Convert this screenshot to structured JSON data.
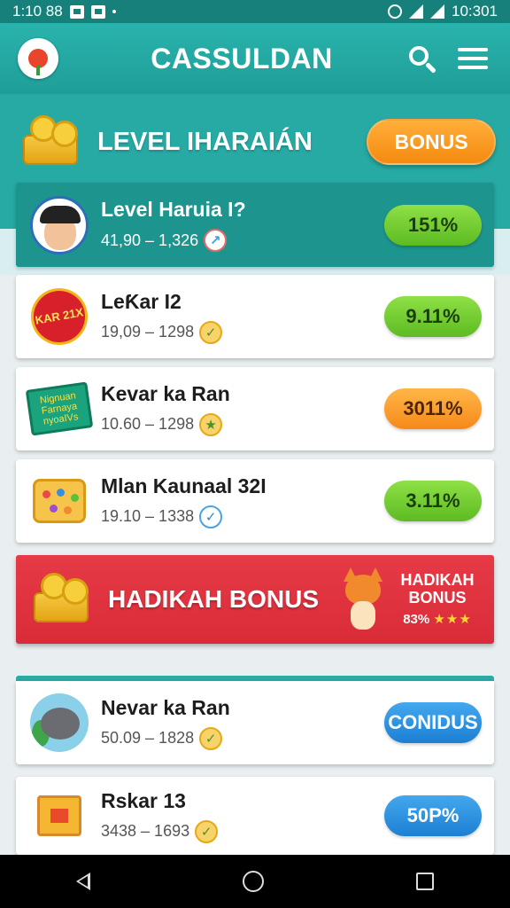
{
  "status_bar": {
    "time_left": "1:10 88",
    "time_right": "10:301"
  },
  "app_bar": {
    "title": "CASSULDAN"
  },
  "banner": {
    "title": "LEVEL IHARAIÁN",
    "bonus_label": "BONUS"
  },
  "featured": {
    "name": "Level Haruia I?",
    "range": "41,90 – 1,326",
    "badge": "↗",
    "percent": "151%"
  },
  "items": [
    {
      "name": "LeƘar I2",
      "range": "19,09 – 1298",
      "badge": "✓",
      "percent": "9.11%",
      "thumb_text": "KAR 21X",
      "pill_color": "green"
    },
    {
      "name": "Kevar ka Ran",
      "range": "10.60 – 1298",
      "badge": "★",
      "percent": "3011%",
      "thumb_text": "Nignuan Farnaya nyoaIVs",
      "pill_color": "orange"
    },
    {
      "name": "Mlan Kaunaal 32I",
      "range": "19.10 – 1338",
      "badge": "✓",
      "percent": "3.11%",
      "pill_color": "green"
    }
  ],
  "promo": {
    "title": "HADIKAH BONUS",
    "side_title": "HADIKAH BONUS",
    "rating": "83%",
    "stars": "★★★"
  },
  "items2": [
    {
      "name": "Nevar ka Ran",
      "range": "50.09 – 1828",
      "badge": "✓",
      "button": "CONIDUS",
      "pill_color": "blue"
    },
    {
      "name": "Rskar 13",
      "range": "3438 – 1693",
      "badge": "✓",
      "button": "50P%",
      "pill_color": "blue"
    }
  ],
  "icons": {
    "search": "search-icon",
    "menu": "menu-icon",
    "logo": "flower-logo-icon",
    "back": "back-icon",
    "home": "home-icon",
    "recent": "recent-apps-icon"
  },
  "colors": {
    "teal": "#27aaa4",
    "red_promo": "#e03442",
    "green_pill": "#6fc92e",
    "orange_pill": "#f89a25",
    "blue_pill": "#2b8fe0"
  }
}
